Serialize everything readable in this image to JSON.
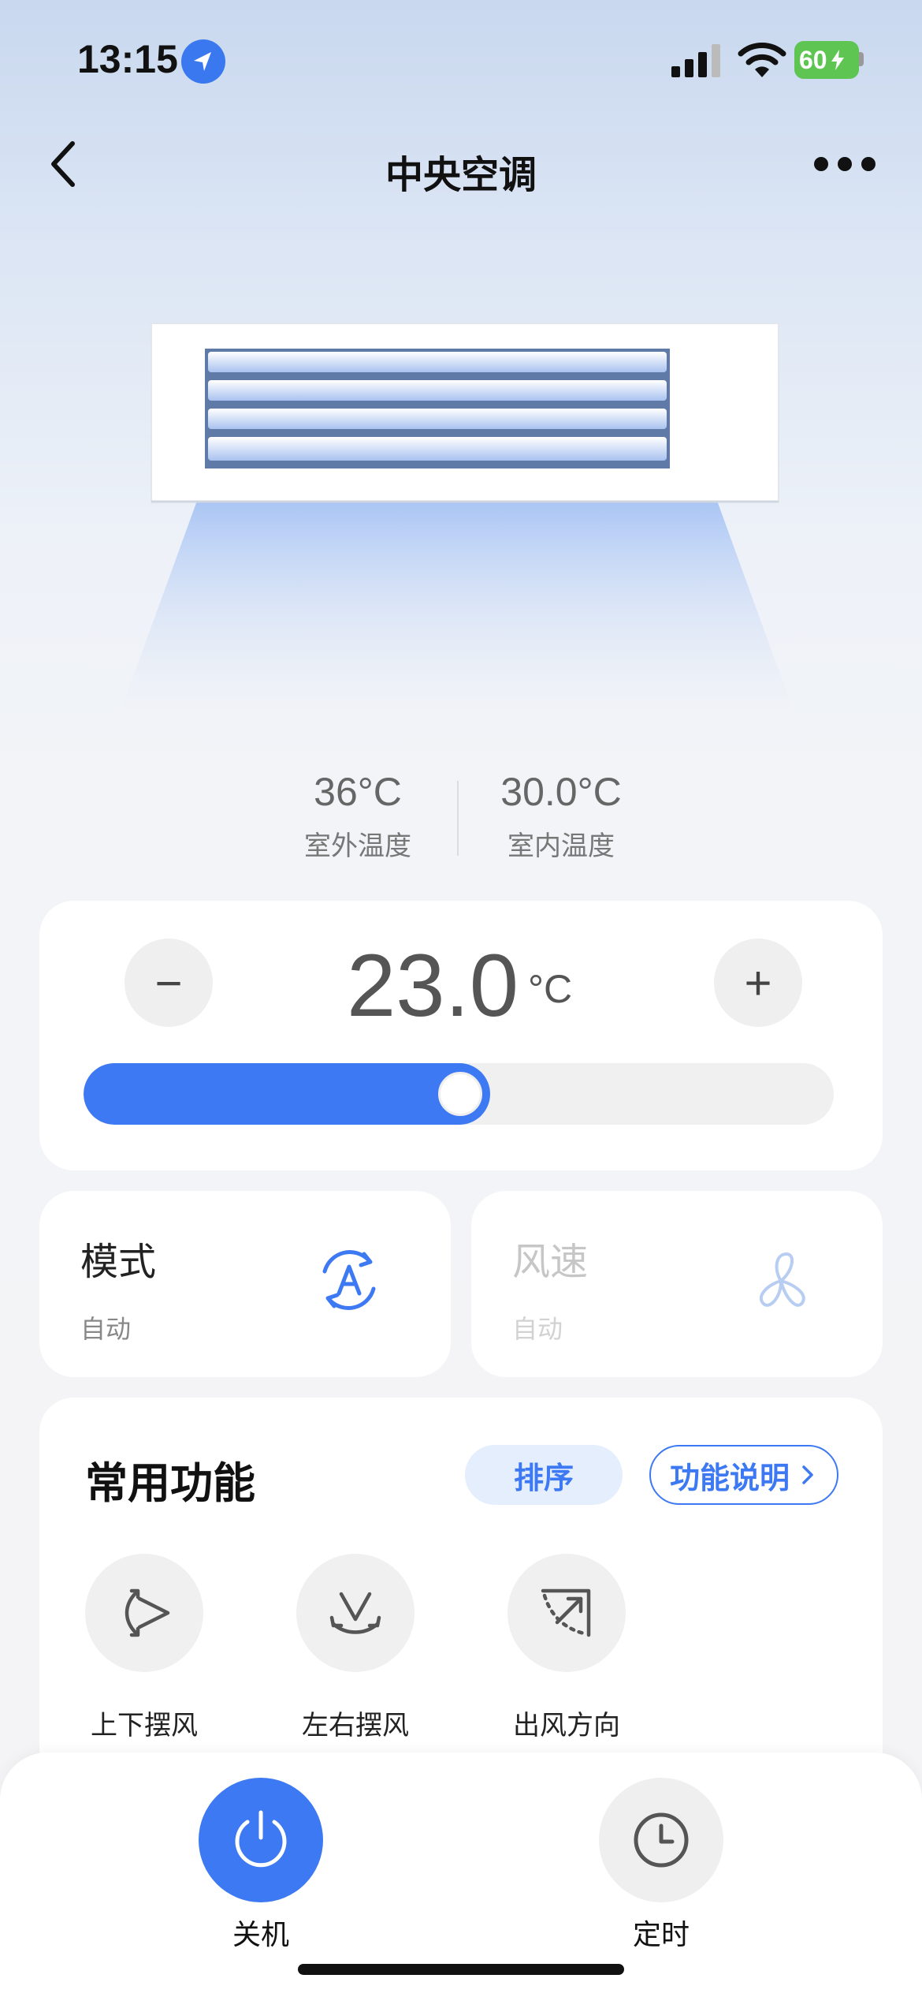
{
  "status_bar": {
    "time": "13:15",
    "battery": "60"
  },
  "header": {
    "title": "中央空调"
  },
  "climate": {
    "outdoor_temp": "36°C",
    "outdoor_label": "室外温度",
    "indoor_temp": "30.0°C",
    "indoor_label": "室内温度"
  },
  "setpoint": {
    "value": "23.0",
    "unit": "°C",
    "minus_label": "−",
    "plus_label": "+",
    "slider_fraction": 0.5
  },
  "mode": {
    "title": "模式",
    "value": "自动"
  },
  "fan_speed": {
    "title": "风速",
    "value": "自动"
  },
  "functions": {
    "title": "常用功能",
    "sort_label": "排序",
    "help_label": "功能说明",
    "items": [
      {
        "label": "上下摆风",
        "icon": "vertical-swing-icon"
      },
      {
        "label": "左右摆风",
        "icon": "horizontal-swing-icon"
      },
      {
        "label": "出风方向",
        "icon": "airflow-direction-icon"
      }
    ]
  },
  "bottom": {
    "power_label": "关机",
    "timer_label": "定时"
  },
  "colors": {
    "accent": "#3d79f2",
    "accent_light": "#e5eefc"
  }
}
